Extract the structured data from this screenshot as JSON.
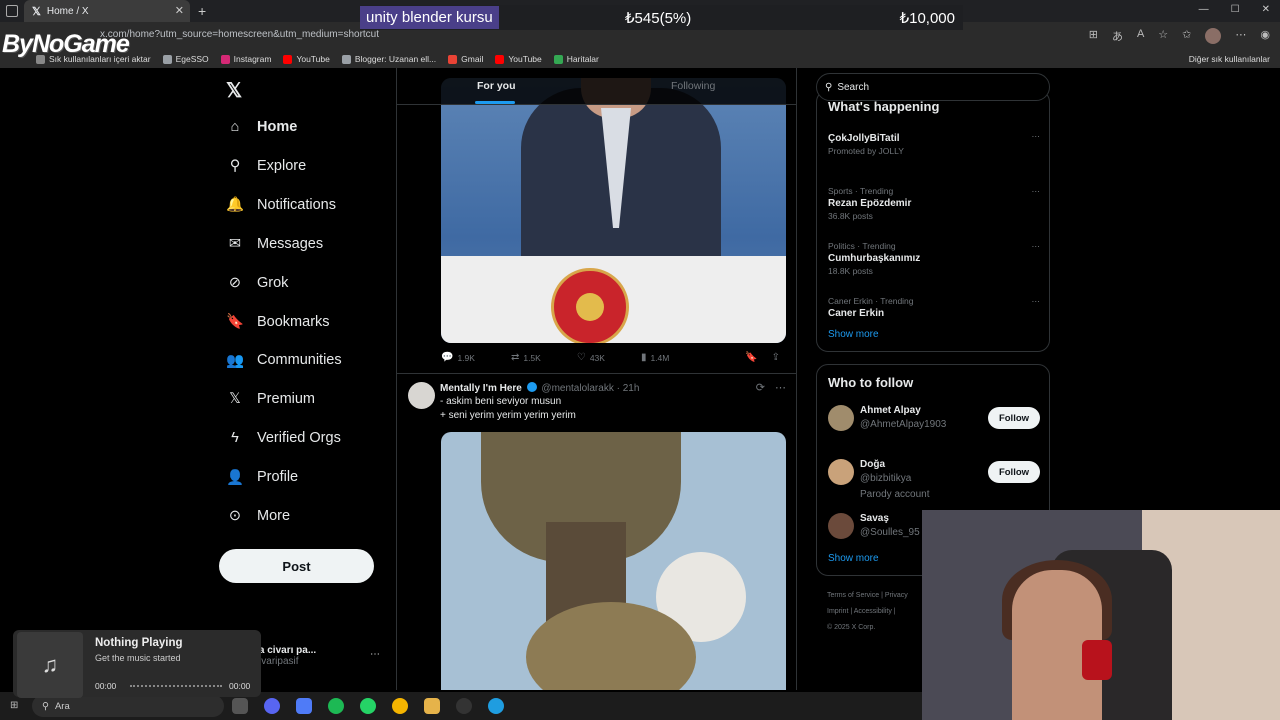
{
  "browser": {
    "tab_title": "Home / X",
    "url": "x.com/home?utm_source=homescreen&utm_medium=shortcut",
    "bookmarks": [
      {
        "label": "Sık kullanılanları içeri aktar",
        "color": "#888888"
      },
      {
        "label": "EgeSSO",
        "color": "#9aa0a6"
      },
      {
        "label": "Instagram",
        "color": "#d62976"
      },
      {
        "label": "YouTube",
        "color": "#ff0000"
      },
      {
        "label": "Blogger: Uzanan ell...",
        "color": "#9aa0a6"
      },
      {
        "label": "Gmail",
        "color": "#ea4335"
      },
      {
        "label": "YouTube",
        "color": "#ff0000"
      },
      {
        "label": "Haritalar",
        "color": "#34a853"
      }
    ],
    "bookmarks_right": "Diğer sık kullanılanlar"
  },
  "overlay": {
    "logo_text": "ByNoGame",
    "banner_item": "unity blender kursu",
    "banner_progress": "₺545(5%)",
    "banner_goal": "₺10,000"
  },
  "nav": {
    "items": [
      {
        "label": "Home",
        "icon": "home-icon"
      },
      {
        "label": "Explore",
        "icon": "search-icon"
      },
      {
        "label": "Notifications",
        "icon": "bell-icon"
      },
      {
        "label": "Messages",
        "icon": "mail-icon"
      },
      {
        "label": "Grok",
        "icon": "grok-icon"
      },
      {
        "label": "Bookmarks",
        "icon": "bookmark-icon"
      },
      {
        "label": "Communities",
        "icon": "communities-icon"
      },
      {
        "label": "Premium",
        "icon": "x-icon"
      },
      {
        "label": "Verified Orgs",
        "icon": "lightning-icon"
      },
      {
        "label": "Profile",
        "icon": "person-icon"
      },
      {
        "label": "More",
        "icon": "more-circle-icon"
      }
    ],
    "post_label": "Post",
    "account_name": "antalya civarı pa...",
    "account_handle": "@antcivaripasif"
  },
  "feed": {
    "tabs": {
      "for_you": "For you",
      "following": "Following"
    },
    "tweet1_stats": {
      "replies": "1.9K",
      "retweets": "1.5K",
      "likes": "43K",
      "views": "1.4M"
    },
    "tweet2": {
      "name": "Mentally I'm Here",
      "handle": "@mentalolarakk",
      "time": "· 21h",
      "line1": "-  askim beni seviyor musun",
      "line2": "+  seni yerim yerim yerim yerim"
    }
  },
  "right": {
    "search_placeholder": "Search",
    "happening_title": "What's happening",
    "trends": [
      {
        "meta": "",
        "name": "ÇokJollyBiTatil",
        "posts": "Promoted by JOLLY"
      },
      {
        "meta": "Sports · Trending",
        "name": "Rezan Epözdemir",
        "posts": "36.8K posts"
      },
      {
        "meta": "Politics · Trending",
        "name": "Cumhurbaşkanımız",
        "posts": "18.8K posts"
      },
      {
        "meta": "Caner Erkin · Trending",
        "name": "Caner Erkin",
        "posts": ""
      }
    ],
    "show_more": "Show more",
    "who_title": "Who to follow",
    "who": [
      {
        "name": "Ahmet Alpay",
        "handle": "@AhmetAlpay1903",
        "extra": "",
        "follow": "Follow",
        "color": "#a08c6c"
      },
      {
        "name": "Doğa",
        "handle": "@bizbitikya",
        "extra": "Parody account",
        "follow": "Follow",
        "color": "#c9a27a"
      },
      {
        "name": "Savaş",
        "handle": "@Soulles_95",
        "extra": "",
        "follow": "",
        "color": "#6b4a3b"
      }
    ],
    "footer": [
      "Terms of Service |",
      "Privacy",
      "Imprint |",
      "Accessibility |",
      "© 2025 X Corp."
    ]
  },
  "music": {
    "title": "Nothing Playing",
    "subtitle": "Get the music started",
    "time_start": "00:00",
    "time_end": "00:00"
  },
  "taskbar": {
    "search": "Ara"
  }
}
